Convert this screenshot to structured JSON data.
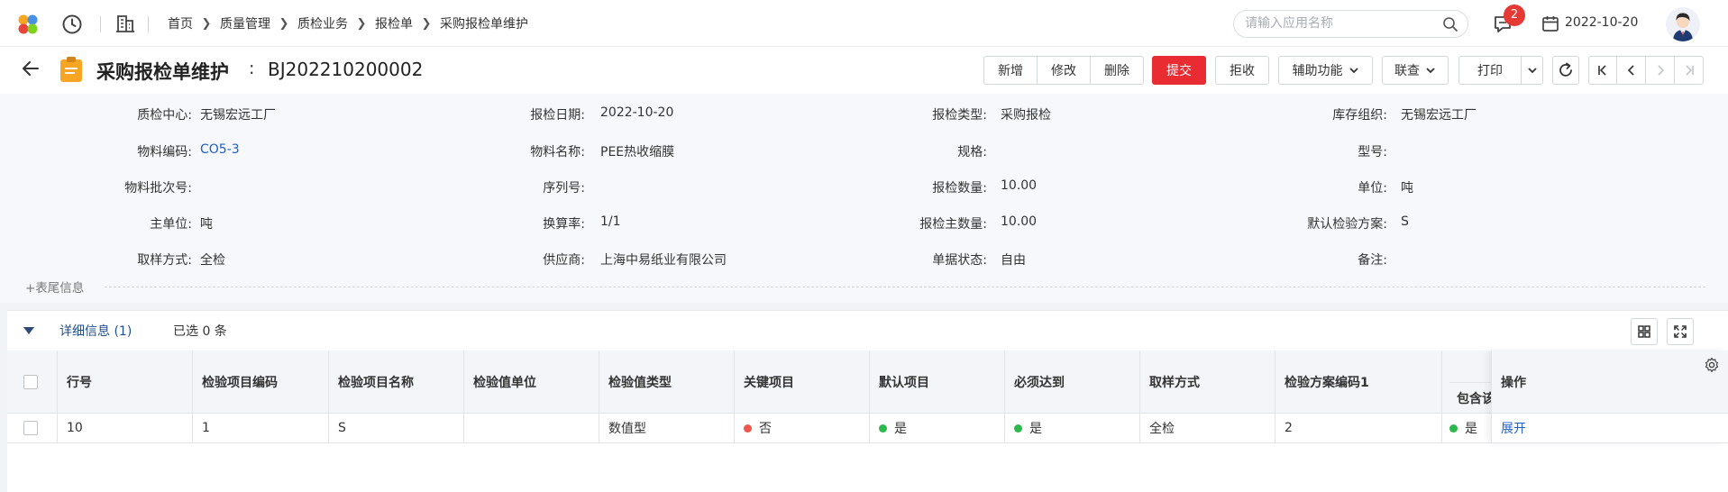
{
  "topbar": {
    "breadcrumbs": [
      "首页",
      "质量管理",
      "质检业务",
      "报检单",
      "采购报检单维护"
    ],
    "search_placeholder": "请输入应用名称",
    "message_count": "2",
    "date": "2022-10-20"
  },
  "titlebar": {
    "title": "采购报检单维护",
    "colon": ":",
    "doc_no": "BJ202210200002",
    "buttons": {
      "add": "新增",
      "edit": "修改",
      "delete": "删除",
      "submit": "提交",
      "reject": "拒收",
      "assist": "辅助功能",
      "link": "联查",
      "print": "打印"
    }
  },
  "form": {
    "rows": [
      [
        {
          "label": "质检中心:",
          "value": "无锡宏远工厂"
        },
        {
          "label": "报检日期:",
          "value": "2022-10-20"
        },
        {
          "label": "报检类型:",
          "value": "采购报检"
        },
        {
          "label": "库存组织:",
          "value": "无锡宏远工厂"
        }
      ],
      [
        {
          "label": "物料编码:",
          "value": "CO5-3"
        },
        {
          "label": "物料名称:",
          "value": "PEE热收缩膜"
        },
        {
          "label": "规格:",
          "value": ""
        },
        {
          "label": "型号:",
          "value": ""
        }
      ],
      [
        {
          "label": "物料批次号:",
          "value": ""
        },
        {
          "label": "序列号:",
          "value": ""
        },
        {
          "label": "报检数量:",
          "value": "10.00"
        },
        {
          "label": "单位:",
          "value": "吨"
        }
      ],
      [
        {
          "label": "主单位:",
          "value": "吨"
        },
        {
          "label": "换算率:",
          "value": "1/1"
        },
        {
          "label": "报检主数量:",
          "value": "10.00"
        },
        {
          "label": "默认检验方案:",
          "value": "S"
        }
      ],
      [
        {
          "label": "取样方式:",
          "value": "全检"
        },
        {
          "label": "供应商:",
          "value": "上海中易纸业有限公司"
        },
        {
          "label": "单据状态:",
          "value": "自由"
        },
        {
          "label": "备注:",
          "value": ""
        }
      ]
    ],
    "tail_label": "+表尾信息"
  },
  "detail": {
    "tab_label": "详细信息 (1)",
    "selected_info": "已选 0 条",
    "columns": [
      "行号",
      "检验项目编码",
      "检验项目名称",
      "检验值单位",
      "检验值类型",
      "关键项目",
      "默认项目",
      "必须达到",
      "取样方式",
      "检验方案编码1"
    ],
    "sub_column": "包含该项",
    "op_column": "操作",
    "row": {
      "line_no": "10",
      "item_code": "1",
      "item_name": "S",
      "unit": "",
      "value_type": "数值型",
      "key_item": "否",
      "default_item": "是",
      "must_reach": "是",
      "sampling": "全检",
      "scheme_code": "2",
      "contains": "是",
      "op_link": "展开"
    },
    "colors": {
      "no_dot": "#f0574c",
      "yes_dot": "#2db84d"
    }
  }
}
